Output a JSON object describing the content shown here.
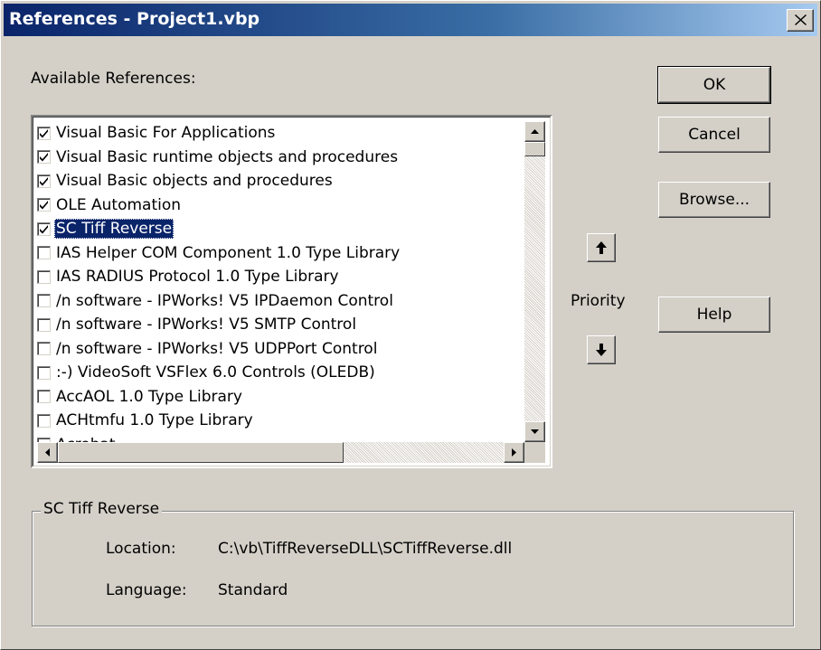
{
  "window": {
    "title": "References - Project1.vbp",
    "close_glyph": "×"
  },
  "available_label": "Available References:",
  "references": [
    {
      "label": "Visual Basic For Applications",
      "checked": true,
      "selected": false
    },
    {
      "label": "Visual Basic runtime objects and procedures",
      "checked": true,
      "selected": false
    },
    {
      "label": "Visual Basic objects and procedures",
      "checked": true,
      "selected": false
    },
    {
      "label": "OLE Automation",
      "checked": true,
      "selected": false
    },
    {
      "label": "SC Tiff Reverse",
      "checked": true,
      "selected": true
    },
    {
      "label": " IAS Helper COM Component 1.0 Type Library",
      "checked": false,
      "selected": false
    },
    {
      "label": " IAS RADIUS Protocol 1.0 Type Library",
      "checked": false,
      "selected": false
    },
    {
      "label": "/n software - IPWorks! V5 IPDaemon Control",
      "checked": false,
      "selected": false
    },
    {
      "label": "/n software - IPWorks! V5 SMTP Control",
      "checked": false,
      "selected": false
    },
    {
      "label": "/n software - IPWorks! V5 UDPPort Control",
      "checked": false,
      "selected": false
    },
    {
      "label": ":-) VideoSoft VSFlex 6.0 Controls (OLEDB)",
      "checked": false,
      "selected": false
    },
    {
      "label": "AccAOL 1.0 Type Library",
      "checked": false,
      "selected": false
    },
    {
      "label": "ACHtmfu 1.0 Type Library",
      "checked": false,
      "selected": false
    },
    {
      "label": "Acrobat",
      "checked": false,
      "selected": false
    }
  ],
  "buttons": {
    "ok": "OK",
    "cancel": "Cancel",
    "browse": "Browse...",
    "help": "Help"
  },
  "priority": {
    "label": "Priority",
    "up_icon": "arrow-up",
    "down_icon": "arrow-down"
  },
  "details": {
    "group_title": "SC Tiff Reverse",
    "location_label": "Location:",
    "location_value": "C:\\vb\\TiffReverseDLL\\SCTiffReverse.dll",
    "language_label": "Language:",
    "language_value": "Standard"
  },
  "colors": {
    "title_gradient_start": "#0a246a",
    "selection": "#0a246a",
    "face": "#d4d0c8"
  }
}
